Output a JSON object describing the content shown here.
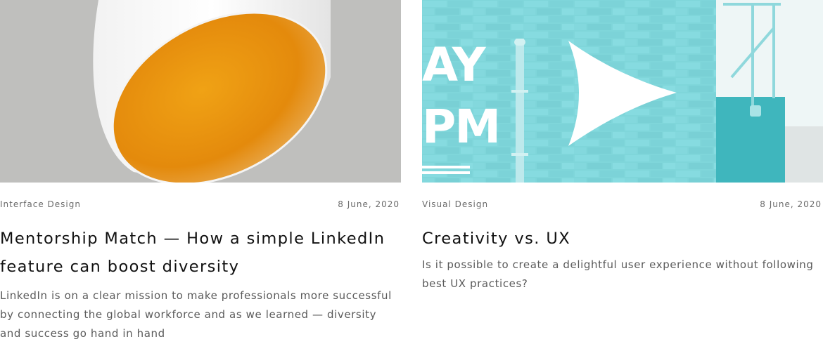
{
  "posts": [
    {
      "category": "Interface Design",
      "date": "8 June, 2020",
      "title": "Mentorship Match — How a simple LinkedIn feature can boost diversity",
      "excerpt": "LinkedIn is on a clear mission to make professionals more successful by connecting the global workforce and as we learned — diversity and success go hand in hand",
      "image": "orange-pendant-lamp"
    },
    {
      "category": "Visual Design",
      "date": "8 June, 2020",
      "title": "Creativity vs. UX",
      "excerpt": "Is it possible to create a delightful user experience without following best UX practices?",
      "image": "teal-brick-wall-arrow",
      "image_text": [
        "AY",
        "PM"
      ]
    }
  ],
  "colors": {
    "lamp_background": "#bfbfbd",
    "lamp_orange": "#e8930e",
    "wall_teal": "#7fd6da",
    "text_dark": "#111111",
    "text_muted": "#5a5a5a"
  }
}
